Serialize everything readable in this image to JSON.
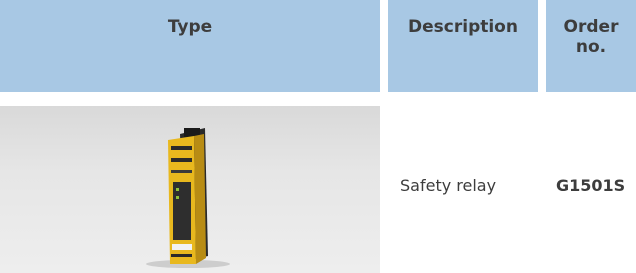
{
  "header": {
    "type": "Type",
    "description": "Description",
    "order_line1": "Order",
    "order_line2": "no."
  },
  "row": {
    "image": "safety-relay-product-photo",
    "description": "Safety relay",
    "order_no": "G1501S"
  },
  "colors": {
    "header_bg": "#a8c8e4",
    "text": "#3d3d3d",
    "relay_yellow": "#e8b81e"
  }
}
